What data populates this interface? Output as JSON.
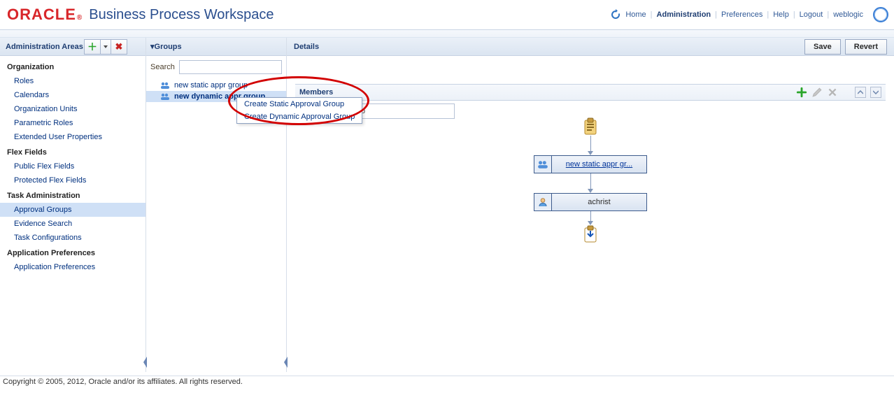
{
  "header": {
    "brand": "ORACLE",
    "title": "Business Process Workspace",
    "links": {
      "home": "Home",
      "admin": "Administration",
      "prefs": "Preferences",
      "help": "Help",
      "logout": "Logout",
      "user": "weblogic"
    }
  },
  "left": {
    "title": "Administration Areas",
    "sections": [
      {
        "heading": "Organization",
        "items": [
          "Roles",
          "Calendars",
          "Organization Units",
          "Parametric Roles",
          "Extended User Properties"
        ]
      },
      {
        "heading": "Flex Fields",
        "items": [
          "Public Flex Fields",
          "Protected Flex Fields"
        ]
      },
      {
        "heading": "Task Administration",
        "items": [
          "Approval Groups",
          "Evidence Search",
          "Task Configurations"
        ],
        "selectedIndex": 0
      },
      {
        "heading": "Application Preferences",
        "items": [
          "Application Preferences"
        ]
      }
    ]
  },
  "mid": {
    "title": "Groups",
    "searchLabel": "Search",
    "searchValue": "",
    "items": [
      {
        "label": "new static appr group",
        "selected": false
      },
      {
        "label": "new dynamic appr group",
        "selected": true
      }
    ],
    "dropdown": {
      "opt1": "Create Static Approval Group",
      "opt2": "Create Dynamic Approval Group"
    }
  },
  "right": {
    "title": "Details",
    "save": "Save",
    "revert": "Revert",
    "nameValue": "ynamic appr group",
    "membersLabel": "Members",
    "flow": {
      "groupLink": "new static appr gr...",
      "userLabel": "achrist"
    }
  },
  "footer": {
    "copyright": "Copyright © 2005, 2012, Oracle and/or its affiliates. All rights reserved."
  }
}
